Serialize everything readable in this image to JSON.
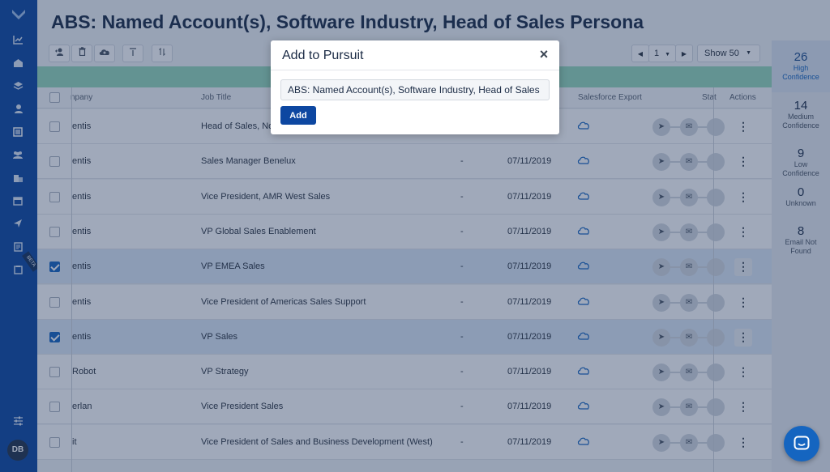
{
  "page_title": "ABS: Named Account(s), Software Industry, Head of Sales Persona",
  "toolbar": {
    "pager_page": "1",
    "show_label": "Show 50"
  },
  "table": {
    "headers": {
      "company": "npany",
      "job_title": "Job Title",
      "salesforce_export": "Salesforce Export",
      "status": "Stat",
      "actions": "Actions"
    },
    "rows": [
      {
        "company": "entis",
        "title": "Head of Sales, Nor",
        "dash": "",
        "date": "",
        "selected": false
      },
      {
        "company": "entis",
        "title": "Sales Manager Benelux",
        "dash": "-",
        "date": "07/11/2019",
        "selected": false
      },
      {
        "company": "entis",
        "title": "Vice President, AMR West Sales",
        "dash": "-",
        "date": "07/11/2019",
        "selected": false
      },
      {
        "company": "entis",
        "title": "VP Global Sales Enablement",
        "dash": "-",
        "date": "07/11/2019",
        "selected": false
      },
      {
        "company": "entis",
        "title": "VP EMEA Sales",
        "dash": "-",
        "date": "07/11/2019",
        "selected": true
      },
      {
        "company": "entis",
        "title": "Vice President of Americas Sales Support",
        "dash": "-",
        "date": "07/11/2019",
        "selected": false
      },
      {
        "company": "entis",
        "title": "VP Sales",
        "dash": "-",
        "date": "07/11/2019",
        "selected": true
      },
      {
        "company": "Robot",
        "title": "VP Strategy",
        "dash": "-",
        "date": "07/11/2019",
        "selected": false
      },
      {
        "company": "erlan",
        "title": "Vice President Sales",
        "dash": "-",
        "date": "07/11/2019",
        "selected": false
      },
      {
        "company": "it",
        "title": "Vice President of Sales and Business Development (West)",
        "dash": "-",
        "date": "07/11/2019",
        "selected": false
      }
    ]
  },
  "stats": [
    {
      "num": "26",
      "label": "High Confidence"
    },
    {
      "num": "14",
      "label": "Medium Confidence"
    },
    {
      "num": "9",
      "label": "Low Confidence"
    },
    {
      "num": "0",
      "label": "Unknown"
    },
    {
      "num": "8",
      "label": "Email Not Found"
    }
  ],
  "rail": {
    "beta_label": "BETA",
    "avatar_initials": "DB"
  },
  "modal": {
    "title": "Add to Pursuit",
    "close_label": "×",
    "input_value": "ABS: Named Account(s), Software Industry, Head of Sales Persona",
    "add_label": "Add"
  },
  "colors": {
    "rail": "#0d47a1",
    "accent": "#1565c0",
    "green_bar": "#97d9bb"
  }
}
